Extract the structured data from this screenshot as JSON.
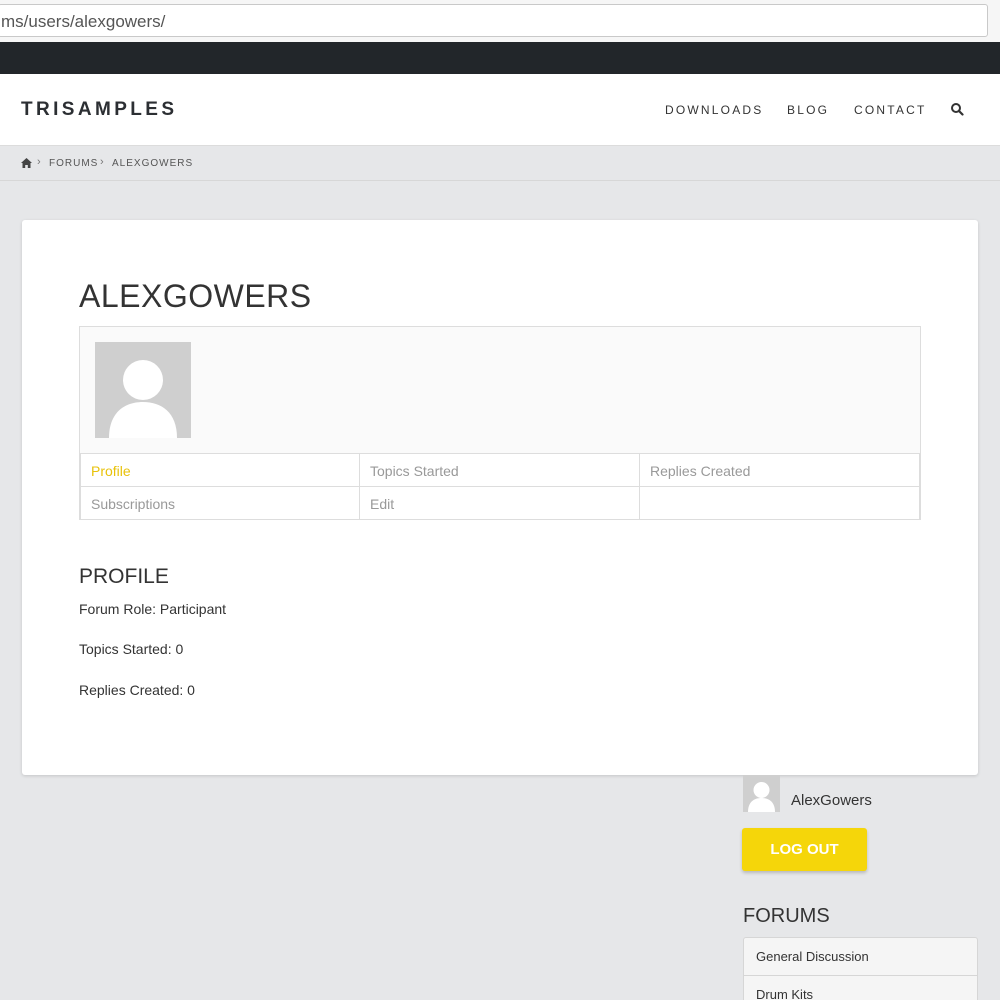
{
  "browser": {
    "url_visible": "ms/users/alexgowers/"
  },
  "header": {
    "logo": "TRISAMPLES",
    "nav": [
      "DOWNLOADS",
      "BLOG",
      "CONTACT"
    ],
    "search_icon": "search-icon"
  },
  "breadcrumb": {
    "home_icon": "home-icon",
    "items": [
      "FORUMS",
      "ALEXGOWERS"
    ],
    "separator": "›"
  },
  "profile": {
    "title": "ALEXGOWERS",
    "avatar_icon": "default-avatar-icon",
    "tabs": [
      {
        "label": "Profile",
        "active": true
      },
      {
        "label": "Topics Started",
        "active": false
      },
      {
        "label": "Replies Created",
        "active": false
      },
      {
        "label": "Subscriptions",
        "active": false
      },
      {
        "label": "Edit",
        "active": false
      }
    ],
    "section_title": "PROFILE",
    "info": [
      "Forum Role: Participant",
      "Topics Started: 0",
      "Replies Created: 0"
    ]
  },
  "sidebar": {
    "username": "AlexGowers",
    "logout_label": "LOG OUT",
    "forums_title": "FORUMS",
    "forums": [
      "General Discussion",
      "Drum Kits"
    ]
  },
  "colors": {
    "accent": "#f5d60a",
    "active_tab": "#e8c20b",
    "topbar": "#22262a",
    "background": "#e6e7e9"
  }
}
